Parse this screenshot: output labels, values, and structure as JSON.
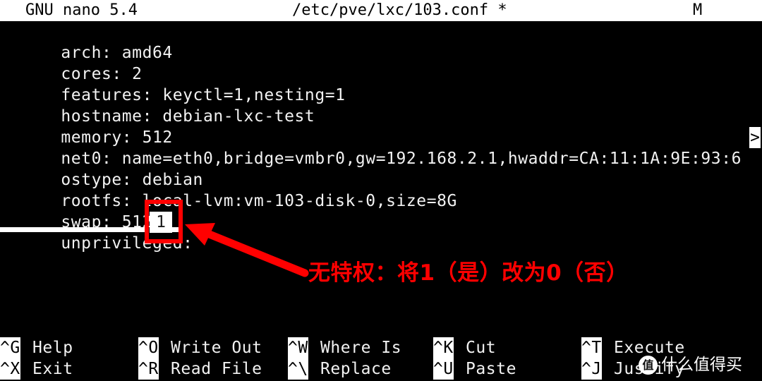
{
  "app": {
    "titlebar": {
      "program": "GNU nano 5.4",
      "filename": "/etc/pve/lxc/103.conf *",
      "mode_flag": "M"
    }
  },
  "editor": {
    "lines": [
      {
        "text": "arch: amd64"
      },
      {
        "text": "cores: 2"
      },
      {
        "text": "features: keyctl=1,nesting=1"
      },
      {
        "text": "hostname: debian-lxc-test"
      },
      {
        "text": "memory: 512"
      },
      {
        "text": "net0: name=eth0,bridge=vmbr0,gw=192.168.2.1,hwaddr=CA:11:1A:9E:93:6"
      },
      {
        "text": "ostype: debian"
      },
      {
        "text": "rootfs: local-lvm:vm-103-disk-0,size=8G"
      },
      {
        "text": "swap: 512"
      },
      {
        "text": "unprivileged:"
      }
    ],
    "continuation_marker": ">",
    "cursor_value": "1"
  },
  "annotation": {
    "text": "无特权：将1（是）改为0（否）",
    "color": "#ff0000"
  },
  "shortcuts": [
    {
      "key": "^G",
      "label": "Help"
    },
    {
      "key": "^X",
      "label": "Exit"
    },
    {
      "key": "^O",
      "label": "Write Out"
    },
    {
      "key": "^R",
      "label": "Read File"
    },
    {
      "key": "^W",
      "label": "Where Is"
    },
    {
      "key": "^\\",
      "label": "Replace"
    },
    {
      "key": "^K",
      "label": "Cut"
    },
    {
      "key": "^U",
      "label": "Paste"
    },
    {
      "key": "^T",
      "label": "Execute"
    },
    {
      "key": "^J",
      "label": "Justify"
    }
  ],
  "watermark": {
    "badge": "值",
    "text": "什么值得买"
  }
}
